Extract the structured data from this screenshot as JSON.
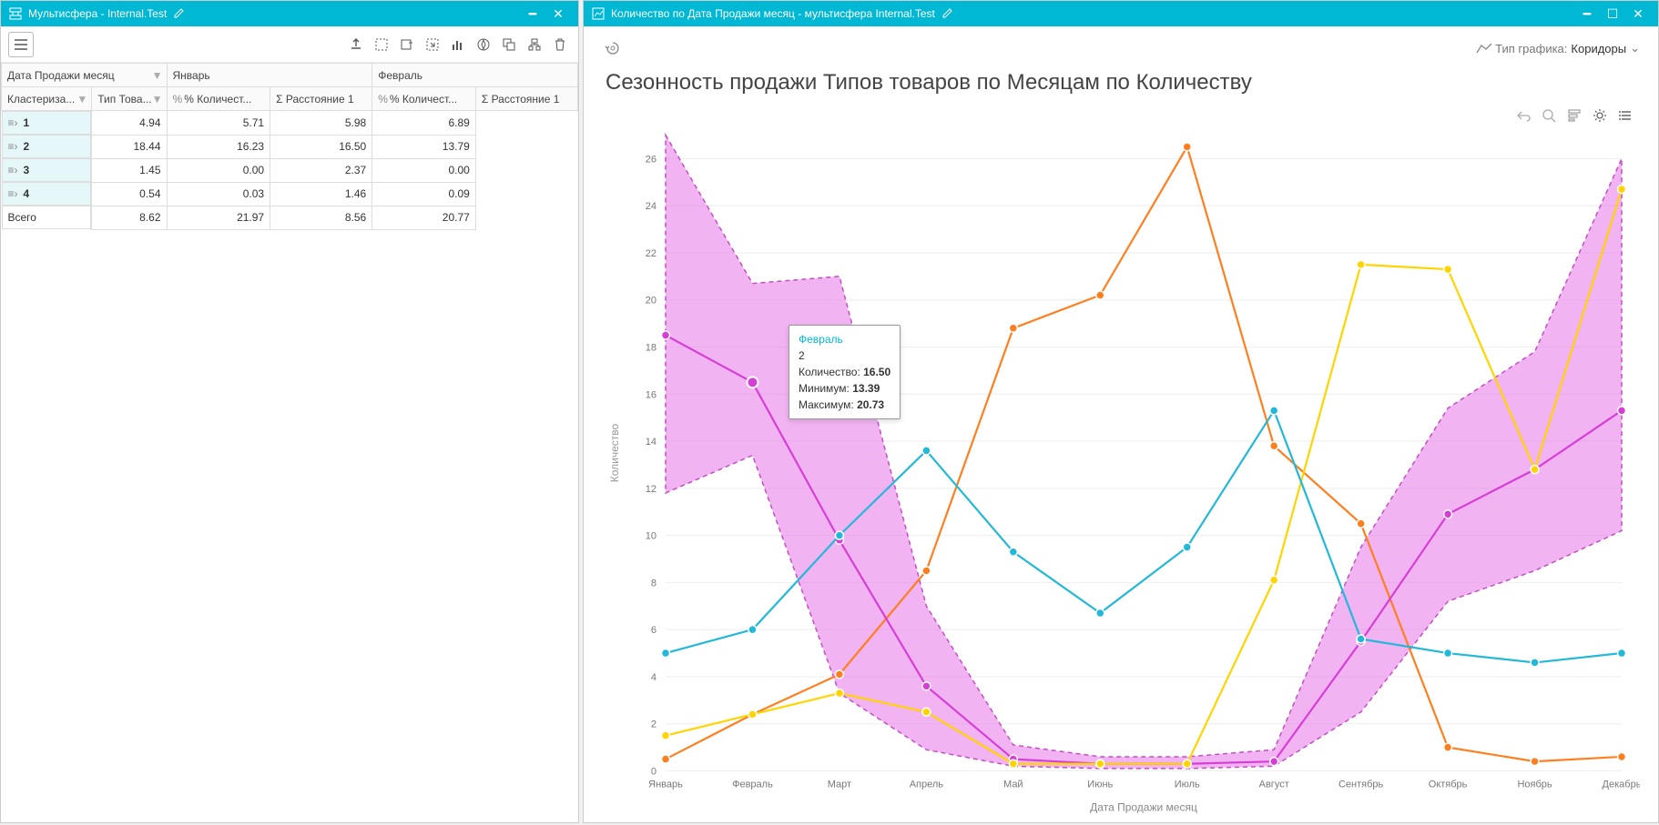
{
  "left": {
    "title": "Мультисфера - Internal.Test",
    "pivot": {
      "top_dim": "Дата Продажи месяц",
      "col_groups": [
        "Январь",
        "Февраль"
      ],
      "row_dims": [
        "Кластериза...",
        "Тип Това..."
      ],
      "measures": [
        "% Количест...",
        "Σ Расстояние 1",
        "% Количест...",
        "Σ Расстояние 1"
      ],
      "rows": [
        {
          "label": "1",
          "vals": [
            "4.94",
            "5.71",
            "5.98",
            "6.89"
          ]
        },
        {
          "label": "2",
          "vals": [
            "18.44",
            "16.23",
            "16.50",
            "13.79"
          ]
        },
        {
          "label": "3",
          "vals": [
            "1.45",
            "0.00",
            "2.37",
            "0.00"
          ]
        },
        {
          "label": "4",
          "vals": [
            "0.54",
            "0.03",
            "1.46",
            "0.09"
          ]
        }
      ],
      "total_label": "Всего",
      "total_vals": [
        "8.62",
        "21.97",
        "8.56",
        "20.77"
      ]
    }
  },
  "right": {
    "title": "Количество по Дата Продажи месяц - мультисфера Internal.Test",
    "chart_title": "Сезонность продажи Типов товаров по Месяцам по Количеству",
    "chart_type_label": "Тип графика:",
    "chart_type_value": "Коридоры",
    "tooltip": {
      "header": "Февраль",
      "row": "2",
      "qty_label": "Количество:",
      "qty_val": "16.50",
      "min_label": "Минимум:",
      "min_val": "13.39",
      "max_label": "Максимум:",
      "max_val": "20.73"
    }
  },
  "chart_data": {
    "type": "line",
    "title": "Сезонность продажи Типов товаров по Месяцам по Количеству",
    "xlabel": "Дата Продажи месяц",
    "ylabel": "Количество",
    "categories": [
      "Январь",
      "Февраль",
      "Март",
      "Апрель",
      "Май",
      "Июнь",
      "Июль",
      "Август",
      "Сентябрь",
      "Октябрь",
      "Ноябрь",
      "Декабрь"
    ],
    "ylim": [
      0,
      27
    ],
    "y_ticks": [
      0,
      2,
      4,
      6,
      8,
      10,
      12,
      14,
      16,
      18,
      20,
      22,
      24,
      26
    ],
    "series": [
      {
        "name": "1",
        "color": "#ff7f1f",
        "values": [
          0.5,
          2.4,
          4.1,
          8.5,
          18.8,
          20.2,
          26.5,
          13.8,
          10.5,
          1.0,
          0.4,
          0.6
        ]
      },
      {
        "name": "2",
        "color": "#d63fd6",
        "values": [
          18.5,
          16.5,
          9.8,
          3.6,
          0.5,
          0.3,
          0.3,
          0.4,
          5.5,
          10.9,
          12.8,
          15.3
        ]
      },
      {
        "name": "3",
        "color": "#ffd400",
        "values": [
          1.5,
          2.4,
          3.3,
          2.5,
          0.3,
          0.3,
          0.3,
          8.1,
          21.5,
          21.3,
          12.8,
          24.7
        ]
      },
      {
        "name": "4",
        "color": "#22b8d8",
        "values": [
          5.0,
          6.0,
          10.0,
          13.6,
          9.3,
          6.7,
          9.5,
          15.3,
          5.6,
          5.0,
          4.6,
          5.0
        ]
      }
    ],
    "band": {
      "series": "2",
      "fill": "#e875e8",
      "upper": [
        27.0,
        20.7,
        21.0,
        7.0,
        1.1,
        0.6,
        0.6,
        0.9,
        9.5,
        15.4,
        17.8,
        26.0
      ],
      "lower": [
        11.8,
        13.4,
        3.3,
        0.9,
        0.2,
        0.1,
        0.1,
        0.2,
        2.5,
        7.2,
        8.5,
        10.2
      ]
    }
  }
}
